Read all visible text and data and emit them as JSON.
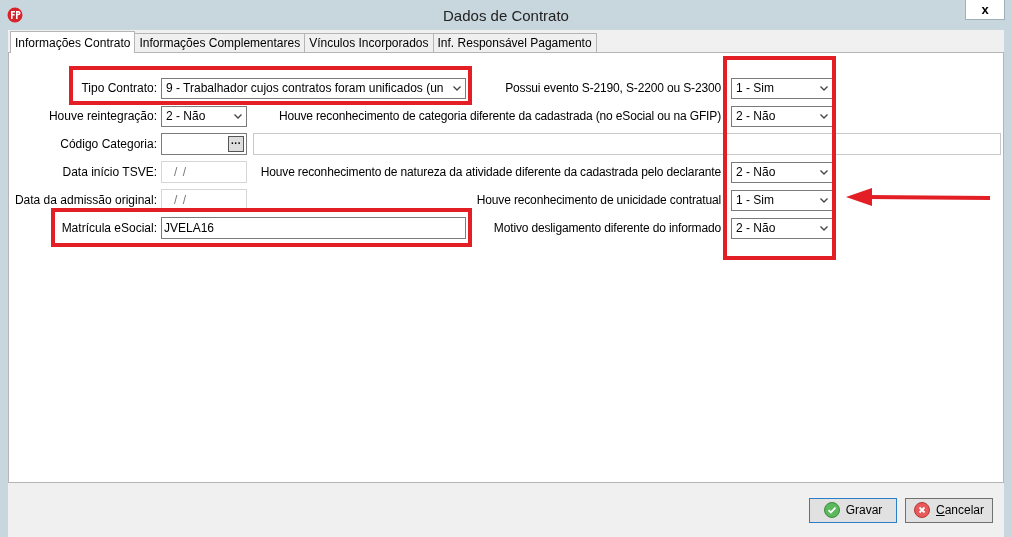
{
  "window": {
    "title": "Dados de Contrato",
    "close": "x"
  },
  "tabs": [
    {
      "label": "Informações Contrato",
      "selected": true
    },
    {
      "label": "Informações Complementares",
      "selected": false
    },
    {
      "label": "Vínculos Incorporados",
      "selected": false
    },
    {
      "label": "Inf. Responsável Pagamento",
      "selected": false
    }
  ],
  "form": {
    "tipo_contrato": {
      "label": "Tipo Contrato:",
      "value": "9 - Trabalhador cujos contratos foram unificados (un"
    },
    "reintegracao": {
      "label": "Houve reintegração:",
      "value": "2 - Não"
    },
    "codigo_categoria": {
      "label": "Código Categoria:",
      "button": "···"
    },
    "data_inicio_tsve": {
      "label": "Data início TSVE:",
      "placeholder": "/ /"
    },
    "data_admissao": {
      "label": "Data da admissão original:",
      "placeholder": "/ /"
    },
    "matricula": {
      "label": "Matrícula eSocial:",
      "value": "JVELA16"
    },
    "questions": [
      {
        "label": "Possui evento S-2190, S-2200 ou S-2300",
        "value": "1 - Sim"
      },
      {
        "label": "Houve reconhecimento de categoria diferente da cadastrada (no eSocial ou na GFIP)",
        "value": "2 - Não"
      },
      {
        "label": "Houve reconhecimento de natureza da atividade diferente da cadastrada pelo declarante",
        "value": "2 - Não"
      },
      {
        "label": "Houve reconhecimento de unicidade contratual",
        "value": "1 - Sim"
      },
      {
        "label": "Motivo desligamento diferente do informado",
        "value": "2 - Não"
      }
    ]
  },
  "buttons": [
    {
      "label": "Gravar",
      "kind": "ok"
    },
    {
      "label": "Cancelar",
      "kind": "cancel"
    }
  ]
}
